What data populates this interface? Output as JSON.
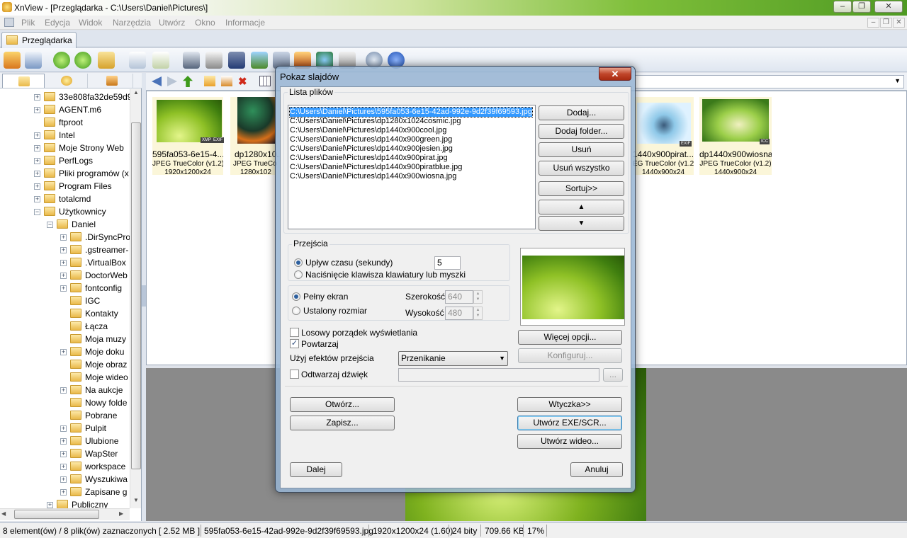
{
  "window": {
    "title": "XnView - [Przeglądarka - C:\\Users\\Daniel\\Pictures\\]",
    "minimize": "‒",
    "maximize": "❐",
    "close": "✕"
  },
  "menu": [
    "Plik",
    "Edycja",
    "Widok",
    "Narzędzia",
    "Utwórz",
    "Okno",
    "Informacje"
  ],
  "mdi_controls": [
    "‒",
    "❐",
    "✕"
  ],
  "tab": {
    "label": "Przeglądarka"
  },
  "tree": [
    {
      "label": "33e808fa32de59d9",
      "level": 1,
      "expander": "+"
    },
    {
      "label": "AGENT.m6",
      "level": 1,
      "expander": "+"
    },
    {
      "label": "ftproot",
      "level": 1,
      "expander": ""
    },
    {
      "label": "Intel",
      "level": 1,
      "expander": "+"
    },
    {
      "label": "Moje Strony Web",
      "level": 1,
      "expander": "+"
    },
    {
      "label": "PerfLogs",
      "level": 1,
      "expander": "+"
    },
    {
      "label": "Pliki programów (x",
      "level": 1,
      "expander": "+"
    },
    {
      "label": "Program Files",
      "level": 1,
      "expander": "+"
    },
    {
      "label": "totalcmd",
      "level": 1,
      "expander": "+"
    },
    {
      "label": "Użytkownicy",
      "level": 1,
      "expander": "−"
    },
    {
      "label": "Daniel",
      "level": 2,
      "expander": "−"
    },
    {
      "label": ".DirSyncPro",
      "level": 3,
      "expander": "+"
    },
    {
      "label": ".gstreamer-",
      "level": 3,
      "expander": "+"
    },
    {
      "label": ".VirtualBox",
      "level": 3,
      "expander": "+"
    },
    {
      "label": "DoctorWeb",
      "level": 3,
      "expander": "+"
    },
    {
      "label": "fontconfig",
      "level": 3,
      "expander": "+"
    },
    {
      "label": "IGC",
      "level": 3,
      "expander": ""
    },
    {
      "label": "Kontakty",
      "level": 3,
      "expander": ""
    },
    {
      "label": "Łącza",
      "level": 3,
      "expander": ""
    },
    {
      "label": "Moja muzy",
      "level": 3,
      "expander": ""
    },
    {
      "label": "Moje doku",
      "level": 3,
      "expander": "+"
    },
    {
      "label": "Moje obraz",
      "level": 3,
      "expander": ""
    },
    {
      "label": "Moje wideo",
      "level": 3,
      "expander": ""
    },
    {
      "label": "Na aukcje",
      "level": 3,
      "expander": "+"
    },
    {
      "label": "Nowy folde",
      "level": 3,
      "expander": ""
    },
    {
      "label": "Pobrane",
      "level": 3,
      "expander": ""
    },
    {
      "label": "Pulpit",
      "level": 3,
      "expander": "+"
    },
    {
      "label": "Ulubione",
      "level": 3,
      "expander": "+"
    },
    {
      "label": "WapSter",
      "level": 3,
      "expander": "+"
    },
    {
      "label": "workspace",
      "level": 3,
      "expander": "+"
    },
    {
      "label": "Wyszukiwa",
      "level": 3,
      "expander": "+"
    },
    {
      "label": "Zapisane g",
      "level": 3,
      "expander": "+"
    },
    {
      "label": "Publiczny",
      "level": 2,
      "expander": "+"
    }
  ],
  "thumbnails": [
    {
      "name": "595fa053-6e15-4...",
      "type": "JPEG TrueColor (v1.2)",
      "size": "1920x1200x24",
      "badges": [
        "XMP",
        "EXIF"
      ]
    },
    {
      "name": "dp1280x10...",
      "type": "JPEG TrueCo",
      "size": "1280x102",
      "badges": []
    },
    {
      "name": "1440x900pirat...",
      "type": "EG TrueColor (v1.2)",
      "size": "1440x900x24",
      "badges": [
        "EXIF"
      ]
    },
    {
      "name": "dp1440x900wiosna",
      "type": "JPEG TrueColor (v1.2)",
      "size": "1440x900x24",
      "badges": [
        "ICC"
      ]
    }
  ],
  "statusbar": {
    "selection": "8 element(ów) / 8 plik(ów) zaznaczonych",
    "total_size": "[ 2.52 MB ]",
    "filename": "595fa053-6e15-42ad-992e-9d2f39f69593.jpg",
    "dimensions": "1920x1200x24 (1.60)",
    "bits": "24 bity",
    "filesize": "709.66 KB",
    "zoom": "17%"
  },
  "dialog": {
    "title": "Pokaz slajdów",
    "close": "✕",
    "files_group": "Lista plików",
    "files": [
      "C:\\Users\\Daniel\\Pictures\\595fa053-6e15-42ad-992e-9d2f39f69593.jpg",
      "C:\\Users\\Daniel\\Pictures\\dp1280x1024cosmic.jpg",
      "C:\\Users\\Daniel\\Pictures\\dp1440x900cool.jpg",
      "C:\\Users\\Daniel\\Pictures\\dp1440x900green.jpg",
      "C:\\Users\\Daniel\\Pictures\\dp1440x900jesien.jpg",
      "C:\\Users\\Daniel\\Pictures\\dp1440x900pirat.jpg",
      "C:\\Users\\Daniel\\Pictures\\dp1440x900piratblue.jpg",
      "C:\\Users\\Daniel\\Pictures\\dp1440x900wiosna.jpg"
    ],
    "buttons": {
      "add": "Dodaj...",
      "add_folder": "Dodaj folder...",
      "remove": "Usuń",
      "remove_all": "Usuń wszystko",
      "sort": "Sortuj>>",
      "up": "▲",
      "down": "▼",
      "more_options": "Więcej opcji...",
      "configure": "Konfiguruj...",
      "browse": "...",
      "open": "Otwórz...",
      "save": "Zapisz...",
      "plugin": "Wtyczka>>",
      "create_exe": "Utwórz EXE/SCR...",
      "create_video": "Utwórz wideo...",
      "next": "Dalej",
      "cancel": "Anuluj"
    },
    "transitions_group": "Przejścia",
    "radio_time": "Upływ czasu (sekundy)",
    "time_value": "5",
    "radio_key": "Naciśnięcie klawisza klawiatury lub myszki",
    "radio_fullscreen": "Pełny ekran",
    "radio_fixed": "Ustalony rozmiar",
    "width_label": "Szerokość",
    "width_value": "640",
    "height_label": "Wysokość",
    "height_value": "480",
    "random_order": "Losowy porządek wyświetlania",
    "random_checked": false,
    "repeat": "Powtarzaj",
    "repeat_checked": true,
    "effects_label": "Użyj efektów przejścia",
    "effect_value": "Przenikanie",
    "play_sound": "Odtwarzaj dźwięk",
    "sound_checked": false,
    "sound_path": ""
  }
}
